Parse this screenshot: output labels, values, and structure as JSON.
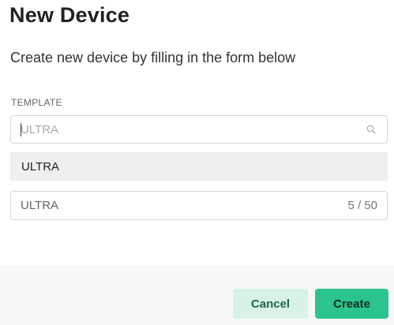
{
  "dialog": {
    "title": "New Device",
    "subtitle": "Create new device by filling in the form below"
  },
  "template_field": {
    "label": "TEMPLATE",
    "placeholder": "ULTRA",
    "value": "",
    "icon": "search-icon"
  },
  "dropdown": {
    "options": [
      {
        "label": "ULTRA",
        "highlighted": true
      }
    ]
  },
  "name_field": {
    "value": "ULTRA",
    "counter": "5 / 50"
  },
  "footer": {
    "cancel_label": "Cancel",
    "create_label": "Create"
  },
  "colors": {
    "primary": "#2bc48a",
    "primary_light": "#d9f2e6",
    "footer_bg": "#f7f7f7",
    "option_highlight": "#efefef"
  }
}
